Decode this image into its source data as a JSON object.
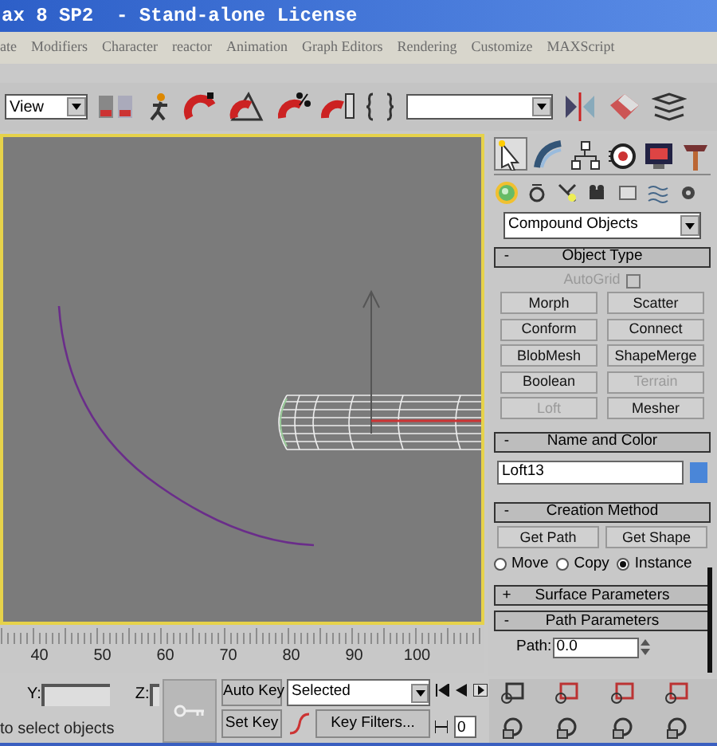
{
  "window": {
    "title": "ax 8 SP2  - Stand-alone License"
  },
  "menu_bar": [
    "ate",
    "Modifiers",
    "Character",
    "reactor",
    "Animation",
    "Graph Editors",
    "Rendering",
    "Customize",
    "MAXScript"
  ],
  "toolbar": {
    "view_dropdown": "View"
  },
  "command_panel": {
    "tabs": [
      {
        "kind": "create",
        "selected": true
      },
      {
        "kind": "modify",
        "selected": false
      },
      {
        "kind": "hierarchy",
        "selected": false
      },
      {
        "kind": "motion",
        "selected": false
      },
      {
        "kind": "display",
        "selected": false
      },
      {
        "kind": "utilities",
        "selected": false
      }
    ],
    "subtabs": [
      {
        "kind": "geometry",
        "selected": true
      },
      {
        "kind": "shapes",
        "selected": false
      },
      {
        "kind": "lights",
        "selected": false
      },
      {
        "kind": "cameras",
        "selected": false
      },
      {
        "kind": "helpers",
        "selected": false
      },
      {
        "kind": "spacewarps",
        "selected": false
      },
      {
        "kind": "systems",
        "selected": false
      }
    ],
    "category_dropdown": "Compound Objects",
    "object_type": {
      "sign": "-",
      "title": "Object Type",
      "autogrid": {
        "label": "AutoGrid",
        "checked": false,
        "disabled": true
      },
      "buttons": [
        {
          "label": "Morph",
          "disabled": false
        },
        {
          "label": "Scatter",
          "disabled": false
        },
        {
          "label": "Conform",
          "disabled": false
        },
        {
          "label": "Connect",
          "disabled": false
        },
        {
          "label": "BlobMesh",
          "disabled": false
        },
        {
          "label": "ShapeMerge",
          "disabled": false
        },
        {
          "label": "Boolean",
          "disabled": false
        },
        {
          "label": "Terrain",
          "disabled": true
        },
        {
          "label": "Loft",
          "disabled": true
        },
        {
          "label": "Mesher",
          "disabled": false
        }
      ]
    },
    "name_and_color": {
      "sign": "-",
      "title": "Name and Color",
      "name": "Loft13",
      "color": "#4a86d8"
    },
    "creation_method": {
      "sign": "-",
      "title": "Creation Method",
      "buttons": [
        "Get Path",
        "Get Shape"
      ],
      "options": [
        {
          "label": "Move",
          "selected": false
        },
        {
          "label": "Copy",
          "selected": false
        },
        {
          "label": "Instance",
          "selected": true
        }
      ]
    },
    "surface_parameters": {
      "sign": "+",
      "title": "Surface Parameters"
    },
    "path_parameters": {
      "sign": "-",
      "title": "Path Parameters",
      "path_label": "Path:",
      "path_value": "0.0"
    }
  },
  "timeline": {
    "ticks": [
      "40",
      "50",
      "60",
      "70",
      "80",
      "90",
      "100"
    ]
  },
  "coordinates": {
    "y_label": "Y:",
    "z_label": "Z:"
  },
  "animation": {
    "auto_key": "Auto Key",
    "set_key": "Set Key",
    "key_mode": "Selected",
    "key_filters": "Key Filters...",
    "frame": "0"
  },
  "status_bar": {
    "prompt": "to select objects"
  }
}
